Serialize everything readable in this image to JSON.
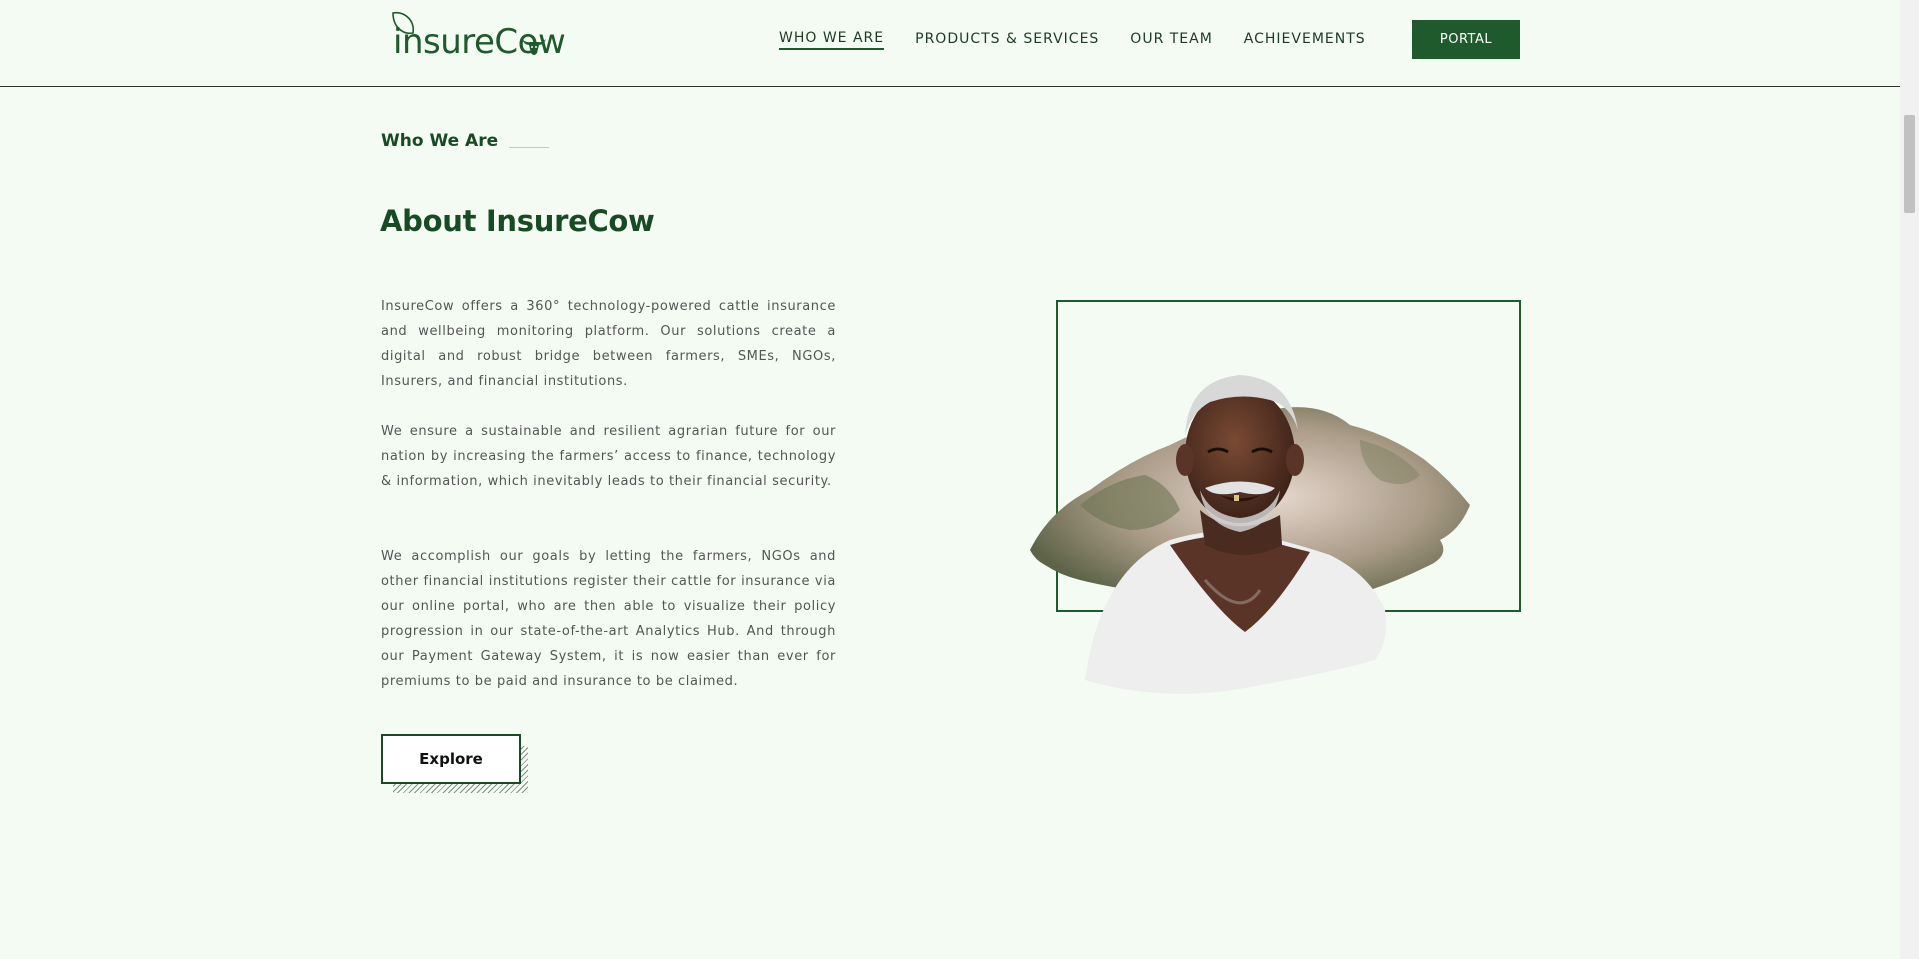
{
  "header": {
    "logo_text": "insureCow",
    "nav": [
      {
        "label": "WHO WE ARE",
        "active": true
      },
      {
        "label": "PRODUCTS & SERVICES",
        "active": false
      },
      {
        "label": "OUR TEAM",
        "active": false
      },
      {
        "label": "ACHIEVEMENTS",
        "active": false
      }
    ],
    "portal_label": "PORTAL"
  },
  "main": {
    "eyebrow": "Who We Are",
    "title": "About InsureCow",
    "paragraphs": [
      "InsureCow offers a 360° technology-powered cattle insurance and wellbeing monitoring platform. Our solutions create a digital and robust bridge between farmers, SMEs, NGOs, Insurers, and financial institutions.",
      "We ensure a sustainable and resilient agrarian future for our nation by increasing the farmers’ access to finance, technology & information, which inevitably leads to their financial security.",
      "We accomplish our goals by letting the farmers, NGOs and other financial institutions register their cattle for insurance via our online portal, who are then able to visualize their policy progression in our state-of-the-art Analytics Hub. And through our Payment Gateway System, it is now easier than ever for premiums to be paid and insurance to be claimed."
    ],
    "explore_label": "Explore"
  },
  "colors": {
    "brand_green": "#1e5a2b",
    "heading_green": "#184b24",
    "page_background": "#f3fbf3"
  },
  "icons": {
    "logo_leaf": "leaf-icon",
    "logo_cow": "cow-head-icon"
  }
}
